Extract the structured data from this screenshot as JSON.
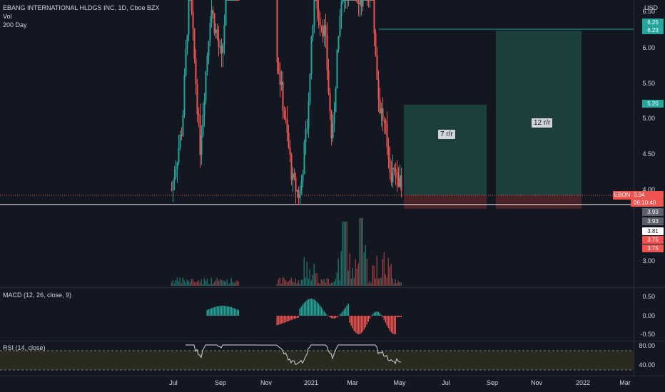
{
  "header": {
    "symbol_title": "EBANG INTERNATIONAL HLDGS INC, 1D, Cboe BZX",
    "vol_label": "Vol",
    "ma_label": "200 Day",
    "currency": "USD"
  },
  "price_axis": {
    "ticks": [
      "6.50",
      "6.00",
      "5.50",
      "5.00",
      "4.50",
      "4.00",
      "3.00"
    ]
  },
  "price_tags": {
    "top_a": "6.25",
    "top_b": "6.23",
    "mid": "5.20",
    "symbol": "EBON",
    "last": "3.94",
    "countdown": "06:10:40",
    "low_a": "3.93",
    "low_b": "3.93",
    "white": "3.81",
    "red_a": "3.75",
    "red_b": "3.75"
  },
  "positions": {
    "left_label": "7 r/r",
    "right_label": "12 r/r"
  },
  "macd": {
    "label": "MACD (12, 26, close, 9)",
    "ticks": [
      "0.50",
      "0.00",
      "-0.50"
    ]
  },
  "rsi": {
    "label": "RSI (14, close)",
    "ticks": [
      "80.00",
      "40.00"
    ]
  },
  "time_axis": {
    "labels": [
      "Jul",
      "Sep",
      "Nov",
      "2021",
      "Mar",
      "May",
      "Jul",
      "Sep",
      "Nov",
      "2022",
      "Mar"
    ]
  },
  "colors": {
    "background": "#131722",
    "up": "#26a69a",
    "down": "#ef5350",
    "target_zone": "#1f4a45",
    "stop_zone": "#5b2a30"
  }
}
